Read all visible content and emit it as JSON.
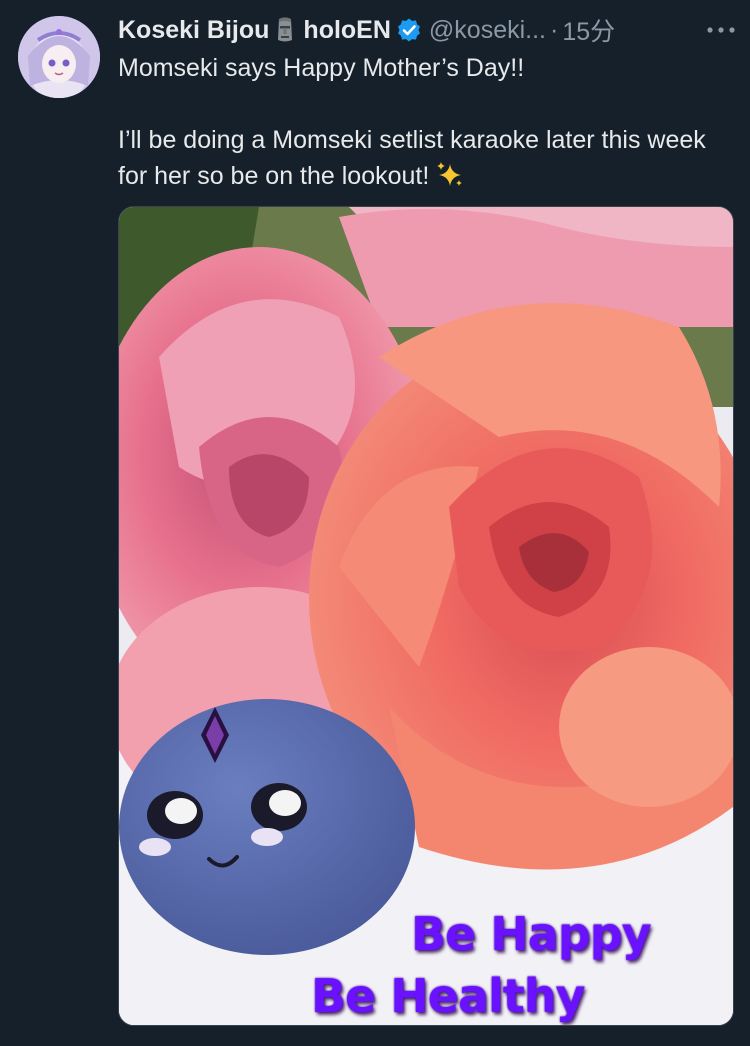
{
  "tweet": {
    "display_name": "Koseki Bijou",
    "affiliation": "holoEN",
    "handle": "@koseki...",
    "separator": "·",
    "time": "15分",
    "text_line_1": "Momseki says Happy Mother’s Day!!",
    "text_line_2": "I’ll be doing a Momseki setlist karaoke later this week for her so be on the lookout!",
    "badges": [
      "moai-icon",
      "verified-icon",
      "sparkles-icon"
    ]
  },
  "media": {
    "caption_line_1": "Be Happy",
    "caption_line_2": "Be Healthy",
    "caption_color": "#6a12ff"
  },
  "colors": {
    "background": "#15202b",
    "text": "#e7e9ea",
    "secondary": "#8b98a5",
    "verified": "#1d9bf0"
  }
}
